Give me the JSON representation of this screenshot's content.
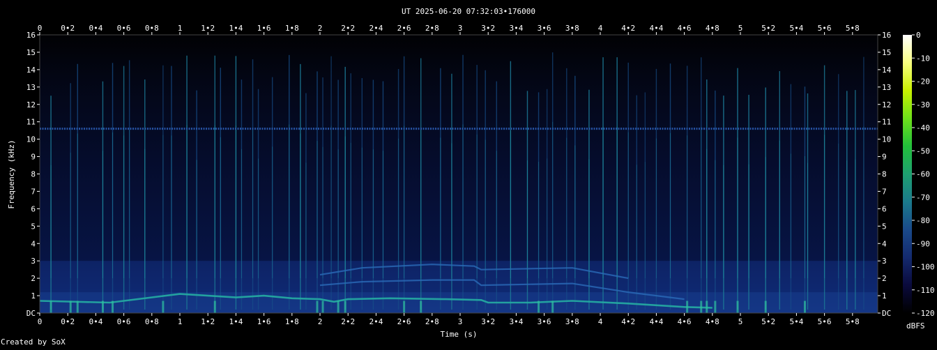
{
  "chart_data": {
    "type": "heatmap",
    "title": "UT 2025-06-20 07:32:03•176000",
    "xlabel": "Time (s)",
    "ylabel": "Frequency (kHz)",
    "xlim": [
      0,
      5.98
    ],
    "ylim": [
      0,
      16
    ],
    "x_ticks": [
      "0",
      "0•2",
      "0•4",
      "0•6",
      "0•8",
      "1",
      "1•2",
      "1•4",
      "1•6",
      "1•8",
      "2",
      "2•2",
      "2•4",
      "2•6",
      "2•8",
      "3",
      "3•2",
      "3•4",
      "3•6",
      "3•8",
      "4",
      "4•2",
      "4•4",
      "4•6",
      "4•8",
      "5",
      "5•2",
      "5•4",
      "5•6",
      "5•8"
    ],
    "y_ticks": [
      "DC",
      "1",
      "2",
      "3",
      "4",
      "5",
      "6",
      "7",
      "8",
      "9",
      "10",
      "11",
      "12",
      "13",
      "14",
      "15",
      "16"
    ],
    "colorbar": {
      "label": "dBFS",
      "ticks": [
        "0",
        "-10",
        "-20",
        "-30",
        "-40",
        "-50",
        "-60",
        "-70",
        "-80",
        "-90",
        "-100",
        "-110",
        "-120"
      ],
      "range": [
        -120,
        0
      ],
      "colors": [
        "#000000",
        "#0a0a3c",
        "#142a6e",
        "#1a4a8a",
        "#1b7a8c",
        "#1ea070",
        "#22c03a",
        "#6ee01a",
        "#c8f000",
        "#f8ff80",
        "#ffffff"
      ]
    },
    "features": {
      "carrier_line_khz": 10.6,
      "fundamental_track": [
        [
          0.0,
          0.7
        ],
        [
          0.5,
          0.6
        ],
        [
          1.0,
          1.1
        ],
        [
          1.4,
          0.9
        ],
        [
          1.6,
          1.0
        ],
        [
          1.8,
          0.85
        ],
        [
          2.0,
          0.8
        ],
        [
          2.1,
          0.65
        ],
        [
          2.2,
          0.8
        ],
        [
          2.5,
          0.85
        ],
        [
          2.9,
          0.8
        ],
        [
          3.15,
          0.75
        ],
        [
          3.2,
          0.6
        ],
        [
          3.5,
          0.6
        ],
        [
          3.8,
          0.7
        ],
        [
          4.2,
          0.55
        ],
        [
          4.6,
          0.35
        ],
        [
          4.8,
          0.3
        ]
      ],
      "harmonic_tracks": [
        [
          [
            2.0,
            1.6
          ],
          [
            2.3,
            1.8
          ],
          [
            2.8,
            1.9
          ],
          [
            3.1,
            1.9
          ],
          [
            3.15,
            1.6
          ],
          [
            3.8,
            1.7
          ],
          [
            4.2,
            1.2
          ],
          [
            4.6,
            0.8
          ]
        ],
        [
          [
            2.0,
            2.2
          ],
          [
            2.3,
            2.6
          ],
          [
            2.8,
            2.8
          ],
          [
            3.1,
            2.7
          ],
          [
            3.15,
            2.5
          ],
          [
            3.8,
            2.6
          ],
          [
            4.2,
            2.0
          ]
        ]
      ],
      "impulse_times_s": [
        0.08,
        0.22,
        0.27,
        0.45,
        0.52,
        0.6,
        0.64,
        0.75,
        0.88,
        0.94,
        1.05,
        1.12,
        1.25,
        1.29,
        1.4,
        1.44,
        1.52,
        1.56,
        1.66,
        1.78,
        1.86,
        1.9,
        1.98,
        2.02,
        2.08,
        2.13,
        2.18,
        2.22,
        2.3,
        2.38,
        2.45,
        2.56,
        2.6,
        2.72,
        2.86,
        2.94,
        3.02,
        3.12,
        3.18,
        3.26,
        3.36,
        3.48,
        3.56,
        3.62,
        3.66,
        3.76,
        3.82,
        3.92,
        4.02,
        4.12,
        4.2,
        4.26,
        4.32,
        4.4,
        4.5,
        4.62,
        4.72,
        4.76,
        4.82,
        4.88,
        4.98,
        5.06,
        5.18,
        5.28,
        5.36,
        5.46,
        5.48,
        5.6,
        5.7,
        5.76,
        5.82,
        5.88
      ]
    }
  },
  "credit": "Created by SoX"
}
